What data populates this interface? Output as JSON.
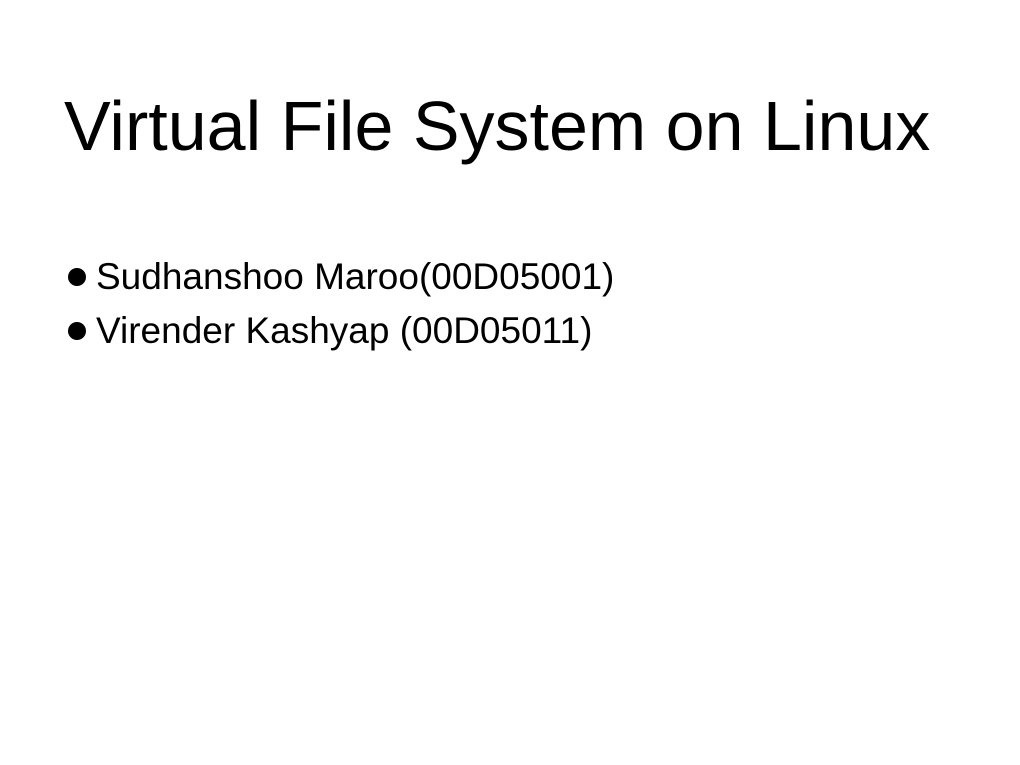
{
  "slide": {
    "title": "Virtual File System on Linux",
    "bullets": [
      "Sudhanshoo Maroo(00D05001)",
      "Virender Kashyap (00D05011)"
    ]
  }
}
